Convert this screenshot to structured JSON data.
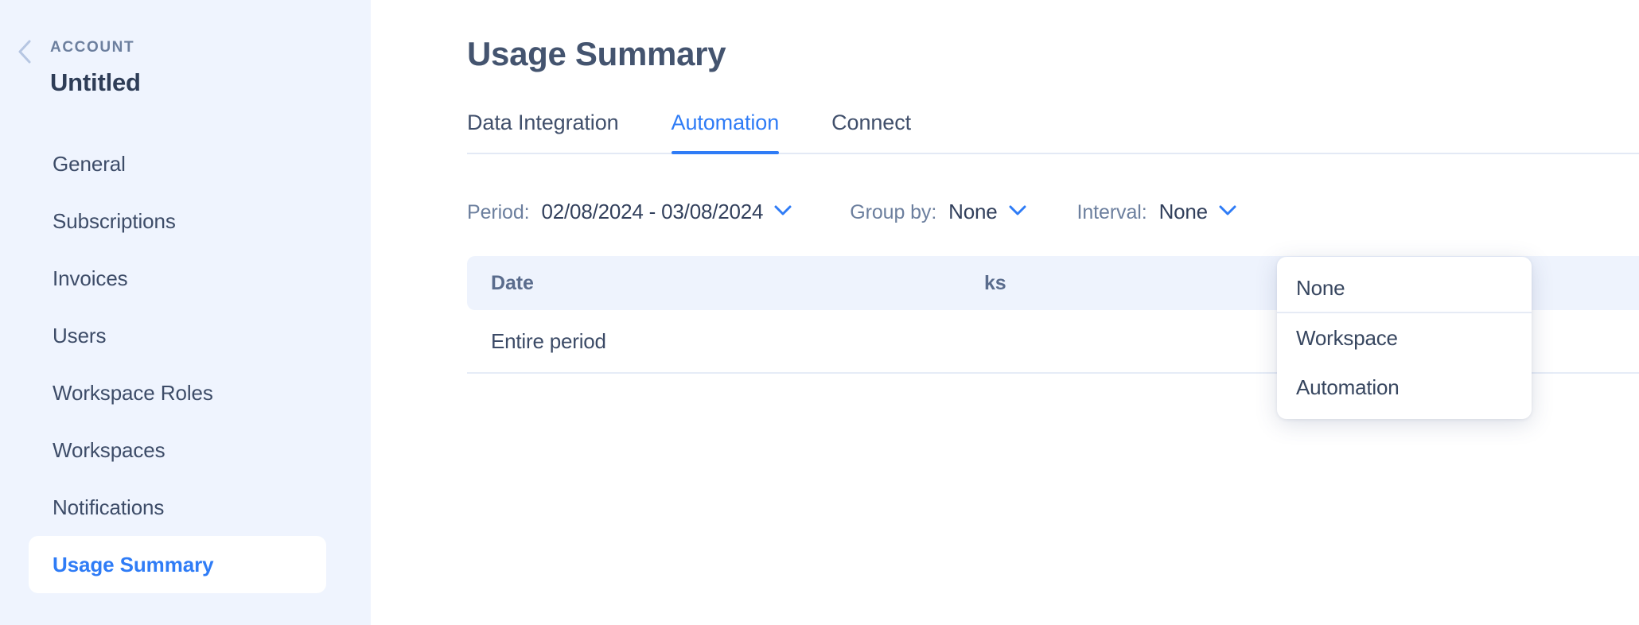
{
  "sidebar": {
    "back_icon": "chevron-left-icon",
    "eyebrow": "ACCOUNT",
    "title": "Untitled",
    "items": [
      {
        "label": "General",
        "active": false
      },
      {
        "label": "Subscriptions",
        "active": false
      },
      {
        "label": "Invoices",
        "active": false
      },
      {
        "label": "Users",
        "active": false
      },
      {
        "label": "Workspace Roles",
        "active": false
      },
      {
        "label": "Workspaces",
        "active": false
      },
      {
        "label": "Notifications",
        "active": false
      },
      {
        "label": "Usage Summary",
        "active": true
      }
    ]
  },
  "main": {
    "page_title": "Usage Summary",
    "tabs": [
      {
        "label": "Data Integration",
        "active": false
      },
      {
        "label": "Automation",
        "active": true
      },
      {
        "label": "Connect",
        "active": false
      }
    ],
    "filters": {
      "period": {
        "label": "Period:",
        "value": "02/08/2024 - 03/08/2024",
        "chevron": "chevron-down-icon"
      },
      "group_by": {
        "label": "Group by:",
        "value": "None",
        "chevron": "chevron-down-icon"
      },
      "interval": {
        "label": "Interval:",
        "value": "None",
        "chevron": "chevron-down-icon"
      }
    },
    "table": {
      "columns": [
        "Date",
        "ks"
      ],
      "rows": [
        {
          "date": "Entire period"
        }
      ]
    },
    "group_by_menu": {
      "options": [
        "None",
        "Workspace",
        "Automation"
      ]
    }
  },
  "colors": {
    "sidebar_bg": "#eff4fe",
    "accent_blue": "#2f7cf6",
    "text_slate": "#3d4c68",
    "table_header_bg": "#eef3fd"
  }
}
